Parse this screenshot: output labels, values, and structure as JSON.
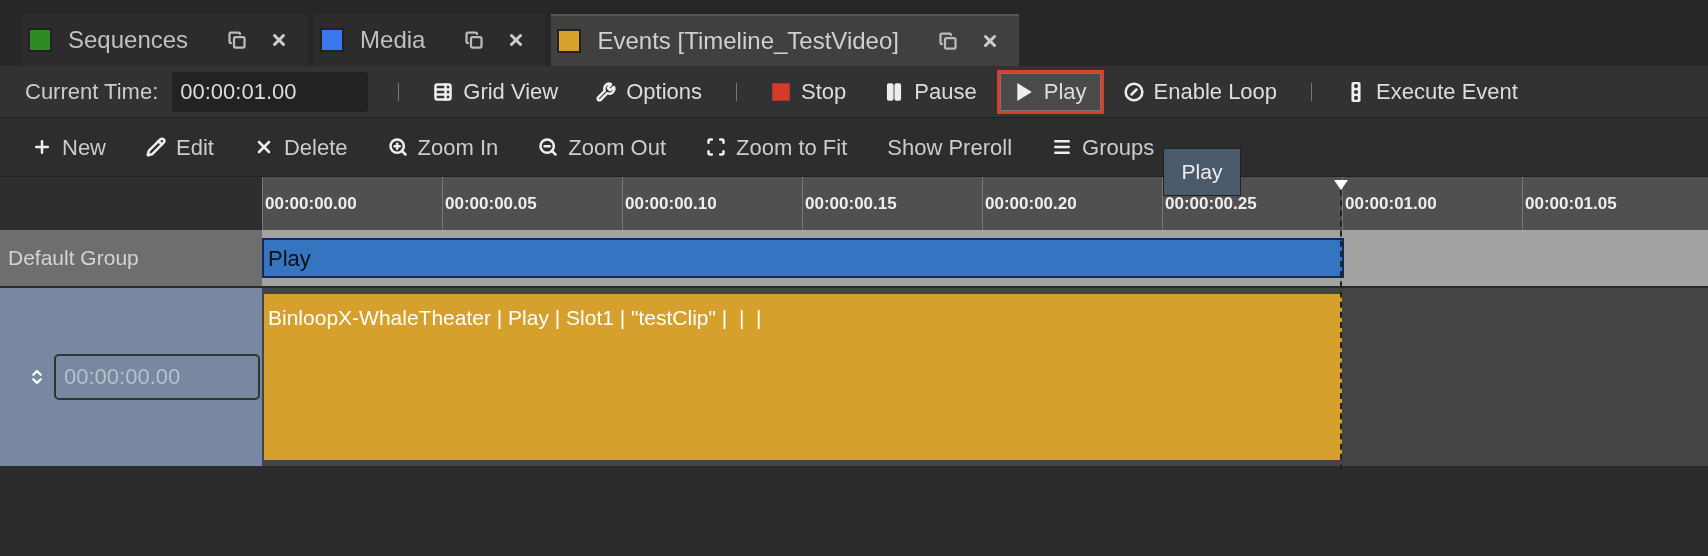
{
  "tabs": [
    {
      "label": "Sequences",
      "color": "#2e8b22",
      "selected": false
    },
    {
      "label": "Media",
      "color": "#3b78f0",
      "selected": false
    },
    {
      "label": "Events [Timeline_TestVideo]",
      "color": "#d9a22a",
      "selected": true
    }
  ],
  "toolbar": [
    {
      "kind": "label",
      "label": "Current Time:"
    },
    {
      "kind": "field",
      "value": "00:00:01.00"
    },
    {
      "kind": "separator"
    },
    {
      "kind": "button",
      "label": "Grid View",
      "selected": false
    },
    {
      "kind": "button",
      "label": "Options",
      "selected": false
    },
    {
      "kind": "separator"
    },
    {
      "kind": "button",
      "label": "Stop",
      "selected": false
    },
    {
      "kind": "button",
      "label": "Pause",
      "selected": false
    },
    {
      "kind": "button",
      "label": "Play",
      "selected": true
    },
    {
      "kind": "button",
      "label": "Enable Loop",
      "selected": false
    },
    {
      "kind": "separator"
    },
    {
      "kind": "button",
      "label": "Execute Event",
      "selected": false
    }
  ],
  "edit_toolbar": [
    "New",
    "Edit",
    "Delete",
    "Zoom In",
    "Zoom Out",
    "Zoom to Fit",
    "Show Preroll",
    "Groups"
  ],
  "tooltip": "Play",
  "ruler": [
    "00:00:00.00",
    "00:00:00.05",
    "00:00:00.10",
    "00:00:00.15",
    "00:00:00.20",
    "00:00:00.25",
    "00:00:01.00",
    "00:00:01.05"
  ],
  "group": {
    "label": "Default Group",
    "bar": "Play"
  },
  "track": {
    "time_value": "00:00:00.00",
    "event": "BinloopX-WhaleTheater | Play | Slot1 | \"testClip\" |  |  |"
  }
}
